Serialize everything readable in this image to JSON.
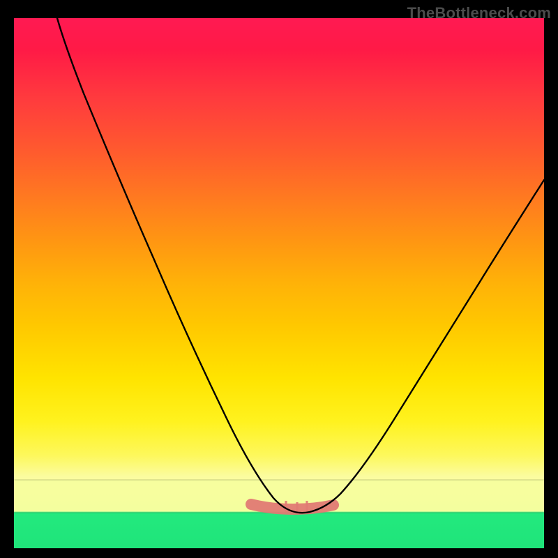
{
  "watermark": "TheBottleneck.com",
  "colors": {
    "top": "#ff1a52",
    "mid": "#ffe400",
    "paleBand": "#f7fe9e",
    "bottom": "#1fe47a",
    "curve": "#000000",
    "highlight": "#e07a74"
  },
  "chart_data": {
    "type": "line",
    "title": "",
    "xlabel": "",
    "ylabel": "",
    "xlim": [
      0,
      100
    ],
    "ylim": [
      0,
      100
    ],
    "grid": false,
    "legend": false,
    "series": [
      {
        "name": "curve",
        "x": [
          8,
          12,
          16,
          20,
          24,
          28,
          32,
          36,
          40,
          44,
          48,
          50,
          52,
          54,
          56,
          58,
          60,
          64,
          68,
          72,
          76,
          80,
          84,
          88,
          92,
          96,
          100
        ],
        "y": [
          100,
          91,
          80,
          69,
          59,
          49,
          40,
          31,
          23,
          16,
          11,
          9,
          8,
          7.5,
          7.5,
          8,
          9,
          12,
          16,
          21,
          27,
          33,
          40,
          47,
          55,
          63,
          71
        ]
      }
    ],
    "highlight_region": {
      "x_start": 45,
      "x_end": 60,
      "note": "flat trough band (~7-9%)"
    },
    "notes": "Background gradient transitions top→bottom through red, orange, yellow, pale-yellow, green. Two faint horizontal dividers near y≈13% and y≈7%. Salmon-colored thick stroke marks the trough region of the curve."
  }
}
